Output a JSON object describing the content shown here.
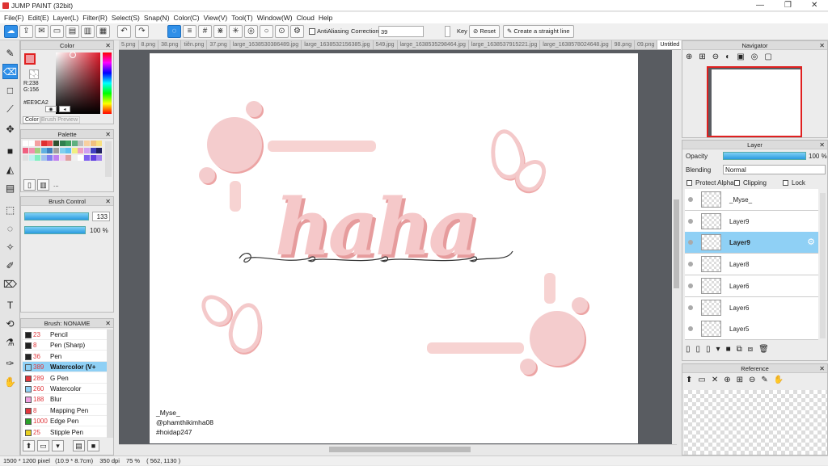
{
  "window": {
    "title": "JUMP PAINT (32bit)"
  },
  "menu": [
    "File(F)",
    "Edit(E)",
    "Layer(L)",
    "Filter(R)",
    "Select(S)",
    "Snap(N)",
    "Color(C)",
    "View(V)",
    "Tool(T)",
    "Window(W)",
    "Cloud",
    "Help"
  ],
  "toolbar": {
    "antialias_label": "AntiAliasing",
    "correction_label": "Correction",
    "correction_value": "39",
    "key_label": "Key",
    "reset_label": "Reset",
    "straight_label": "Create a straight line"
  },
  "tabs": [
    "5.png",
    "8.png",
    "38.png",
    "tiên.png",
    "37.png",
    "large_1638530386489.jpg",
    "large_1638532156385.jpg",
    "549.jpg",
    "large_1638535298464.jpg",
    "large_1638537915221.jpg",
    "large_1638578024648.jpg",
    "98.png",
    "09.png",
    "Untitled"
  ],
  "color_panel": {
    "title": "Color",
    "r": "R:238",
    "g": "G:156",
    "b": "B:162",
    "hex": "#EE9CA2",
    "tab_color": "Color",
    "tab_brush": "Brush Preview",
    "fg": "#EE9CA2"
  },
  "palette_panel": {
    "title": "Palette",
    "more": "..."
  },
  "brush_control": {
    "title": "Brush Control",
    "size": "133",
    "opacity": "100 %"
  },
  "brush_panel": {
    "title": "Brush: NONAME",
    "items": [
      {
        "num": "23",
        "label": "Pencil",
        "color": "#222222"
      },
      {
        "num": "8",
        "label": "Pen (Sharp)",
        "color": "#222222"
      },
      {
        "num": "36",
        "label": "Pen",
        "color": "#222222"
      },
      {
        "num": "389",
        "label": "Watercolor (V+",
        "color": "#8fd0f5",
        "selected": true
      },
      {
        "num": "289",
        "label": "G Pen",
        "color": "#e0383d"
      },
      {
        "num": "260",
        "label": "Watercolor",
        "color": "#8fd0f5"
      },
      {
        "num": "188",
        "label": "Blur",
        "color": "#f0a0e0"
      },
      {
        "num": "8",
        "label": "Mapping Pen",
        "color": "#e0383d"
      },
      {
        "num": "1000",
        "label": "Edge Pen",
        "color": "#2aa02a"
      },
      {
        "num": "25",
        "label": "Stipple Pen",
        "color": "#e8d020"
      }
    ]
  },
  "canvas": {
    "word": "haha",
    "credit_1": "_Myse_",
    "credit_2": "@phamthikimha08",
    "credit_3": "#hoidap247"
  },
  "navigator": {
    "title": "Navigator"
  },
  "layer_panel": {
    "title": "Layer",
    "opacity_label": "Opacity",
    "opacity_value": "100 %",
    "blending_label": "Blending",
    "blending_value": "Normal",
    "protect_alpha": "Protect Alpha",
    "clipping": "Clipping",
    "lock": "Lock",
    "layers": [
      {
        "name": "_Myse_",
        "selected": false
      },
      {
        "name": "Layer9",
        "selected": false
      },
      {
        "name": "Layer9",
        "selected": true
      },
      {
        "name": "Layer8",
        "selected": false
      },
      {
        "name": "Layer6",
        "selected": false
      },
      {
        "name": "Layer6",
        "selected": false
      },
      {
        "name": "Layer5",
        "selected": false
      }
    ]
  },
  "reference": {
    "title": "Reference"
  },
  "status": {
    "size": "1500 * 1200 pixel",
    "cm": "(10.9 * 8.7cm)",
    "dpi": "350 dpi",
    "zoom": "75 %",
    "coords": "( 562, 1130 )"
  }
}
